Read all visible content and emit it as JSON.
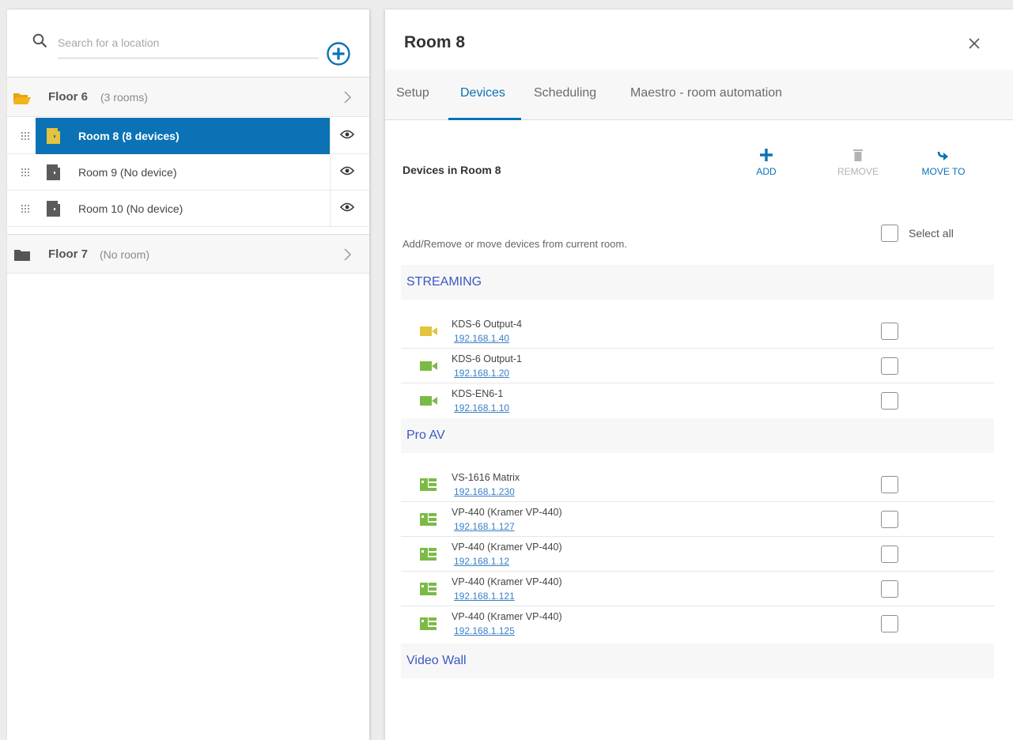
{
  "colors": {
    "accent": "#0b72b5",
    "group_header_text": "#3b58c4",
    "streaming_icon_yellow": "#e4c33d",
    "device_icon_green": "#7cba47",
    "folder_open": "#f2b418"
  },
  "sidebar": {
    "search": {
      "placeholder": "Search for a location",
      "value": "",
      "icon": "search-icon"
    },
    "add_icon": "plus-circle-icon",
    "floors": [
      {
        "name": "Floor 6",
        "meta": "(3 rooms)",
        "expanded": true,
        "icon": "folder-open-icon",
        "rooms": [
          {
            "name": "Room 8  (8 devices)",
            "active": true
          },
          {
            "name": "Room 9  (No device)",
            "active": false
          },
          {
            "name": "Room 10  (No device)",
            "active": false
          }
        ]
      },
      {
        "name": "Floor 7",
        "meta": "(No room)",
        "expanded": false,
        "icon": "folder-closed-icon",
        "rooms": []
      }
    ]
  },
  "detail": {
    "title": "Room 8",
    "tabs": [
      {
        "label": "Setup",
        "active": false
      },
      {
        "label": "Devices",
        "active": true
      },
      {
        "label": "Scheduling",
        "active": false
      },
      {
        "label": "Maestro - room automation",
        "active": false
      }
    ],
    "section_title": "Devices in Room 8",
    "actions": {
      "add": "ADD",
      "remove": "REMOVE",
      "move_to": "MOVE TO"
    },
    "hint": "Add/Remove or move devices from current room.",
    "select_all_label": "Select all",
    "groups": [
      {
        "name": "STREAMING",
        "devices": [
          {
            "name": "KDS-6 Output-4",
            "ip": "192.168.1.40",
            "icon": "camera-icon",
            "color": "#e4c33d",
            "checked": false
          },
          {
            "name": "KDS-6 Output-1",
            "ip": "192.168.1.20",
            "icon": "camera-icon",
            "color": "#7cba47",
            "checked": false
          },
          {
            "name": "KDS-EN6-1",
            "ip": "192.168.1.10",
            "icon": "camera-icon",
            "color": "#7cba47",
            "checked": false
          }
        ]
      },
      {
        "name": "Pro AV",
        "devices": [
          {
            "name": "VS-1616 Matrix",
            "ip": "192.168.1.230",
            "icon": "matrix-device-icon",
            "color": "#7cba47",
            "checked": false
          },
          {
            "name": "VP-440 (Kramer VP-440)",
            "ip": "192.168.1.127",
            "icon": "matrix-device-icon",
            "color": "#7cba47",
            "checked": false
          },
          {
            "name": "VP-440 (Kramer VP-440)",
            "ip": "192.168.1.12",
            "icon": "matrix-device-icon",
            "color": "#7cba47",
            "checked": false
          },
          {
            "name": "VP-440 (Kramer VP-440)",
            "ip": "192.168.1.121",
            "icon": "matrix-device-icon",
            "color": "#7cba47",
            "checked": false
          },
          {
            "name": "VP-440 (Kramer VP-440)",
            "ip": "192.168.1.125",
            "icon": "matrix-device-icon",
            "color": "#7cba47",
            "checked": false
          }
        ]
      },
      {
        "name": "Video Wall",
        "devices": []
      }
    ]
  }
}
